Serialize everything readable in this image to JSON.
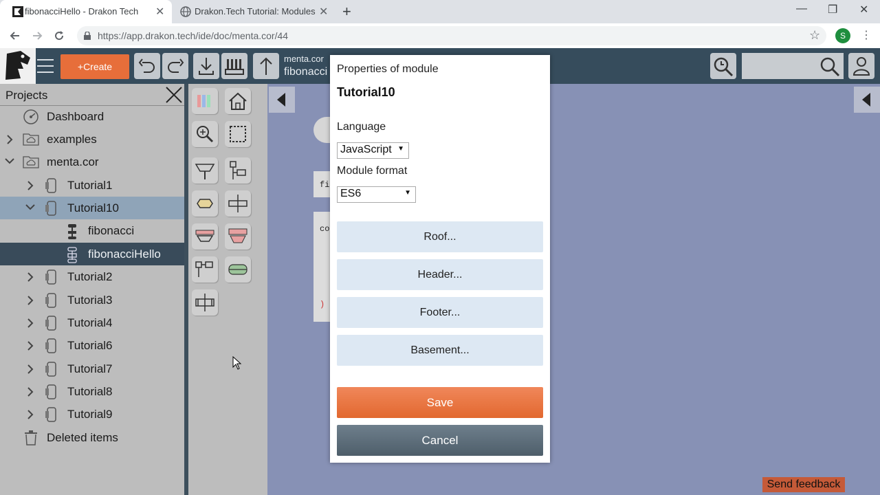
{
  "browser": {
    "tabs": [
      {
        "title": "fibonacciHello - Drakon Tech",
        "active": true
      },
      {
        "title": "Drakon.Tech Tutorial: Modules",
        "active": false
      }
    ],
    "url": "https://app.drakon.tech/ide/doc/menta.cor/44",
    "profile_initial": "S"
  },
  "toolbar": {
    "create_label": "+Create",
    "breadcrumb_folder": "menta.cor",
    "breadcrumb_doc": "fibonacci"
  },
  "sidebar": {
    "title": "Projects",
    "items": [
      {
        "label": "Dashboard",
        "icon": "dashboard-icon"
      },
      {
        "label": "examples",
        "icon": "cloud-folder-icon",
        "expander": "collapsed"
      },
      {
        "label": "menta.cor",
        "icon": "cloud-folder-icon",
        "expander": "expanded"
      },
      {
        "label": "Tutorial1",
        "icon": "module-icon",
        "expander": "collapsed"
      },
      {
        "label": "Tutorial10",
        "icon": "module-icon",
        "expander": "expanded",
        "selected": true
      },
      {
        "label": "fibonacci",
        "icon": "diagram-icon"
      },
      {
        "label": "fibonacciHello",
        "icon": "diagram-icon",
        "current": true
      },
      {
        "label": "Tutorial2",
        "icon": "module-icon",
        "expander": "collapsed"
      },
      {
        "label": "Tutorial3",
        "icon": "module-icon",
        "expander": "collapsed"
      },
      {
        "label": "Tutorial4",
        "icon": "module-icon",
        "expander": "collapsed"
      },
      {
        "label": "Tutorial6",
        "icon": "module-icon",
        "expander": "collapsed"
      },
      {
        "label": "Tutorial7",
        "icon": "module-icon",
        "expander": "collapsed"
      },
      {
        "label": "Tutorial8",
        "icon": "module-icon",
        "expander": "collapsed"
      },
      {
        "label": "Tutorial9",
        "icon": "module-icon",
        "expander": "collapsed"
      },
      {
        "label": "Deleted items",
        "icon": "trash-icon"
      }
    ]
  },
  "canvas": {
    "code_snippets": [
      "fi",
      "co",
      ")"
    ]
  },
  "modal": {
    "title": "Properties of module",
    "module_name": "Tutorial10",
    "language_label": "Language",
    "language_value": "JavaScript",
    "format_label": "Module format",
    "format_value": "ES6",
    "buttons": [
      "Roof...",
      "Header...",
      "Footer...",
      "Basement..."
    ],
    "save_label": "Save",
    "cancel_label": "Cancel"
  },
  "feedback_label": "Send feedback",
  "colors": {
    "toolbar": "#364c5c",
    "create_button": "#e76e3a",
    "sidebar": "#bdbdbd",
    "selected_row": "#8fa4b8",
    "current_row": "#394b5a",
    "canvas": "#8791b5",
    "save": "#e76e3a",
    "cancel": "#5a6a76"
  }
}
